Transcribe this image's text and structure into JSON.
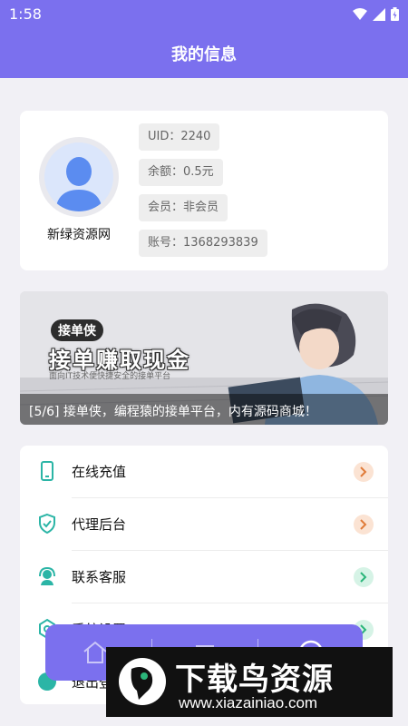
{
  "status_bar": {
    "time": "1:58"
  },
  "header": {
    "title": "我的信息"
  },
  "profile": {
    "username": "新绿资源网",
    "uid": "UID：2240",
    "balance": "余额：0.5元",
    "membership": "会员：非会员",
    "account": "账号：1368293839"
  },
  "banner": {
    "logo_text": "接单侠",
    "headline": "接单赚取现金",
    "subtext": "面向IT技术便快捷安全的接单平台",
    "caption": "[5/6] 接单侠，编程猿的接单平台，内有源码商城！"
  },
  "menu": {
    "items": [
      {
        "label": "在线充值",
        "icon": "phone-icon",
        "icon_color": "#2bb5a6",
        "arrow_bg": "#fbe3d3",
        "arrow_color": "#e07b39"
      },
      {
        "label": "代理后台",
        "icon": "shield-check-icon",
        "icon_color": "#2bb5a6",
        "arrow_bg": "#fbe3d3",
        "arrow_color": "#e07b39"
      },
      {
        "label": "联系客服",
        "icon": "headset-icon",
        "icon_color": "#2bb5a6",
        "arrow_bg": "#d6f3e6",
        "arrow_color": "#2bb57a"
      },
      {
        "label": "系统设置",
        "icon": "settings-icon",
        "icon_color": "#2bb5a6",
        "arrow_bg": "#d6f3e6",
        "arrow_color": "#2bb57a"
      },
      {
        "label": "退出登录",
        "icon": "logout-icon",
        "icon_color": "#2bb5a6"
      }
    ]
  },
  "watermark": {
    "title": "下载鸟资源",
    "url": "www.xiazainiao.com"
  },
  "colors": {
    "primary": "#7b70ee",
    "background": "#f1f0f5",
    "accent": "#2bb5a6"
  }
}
